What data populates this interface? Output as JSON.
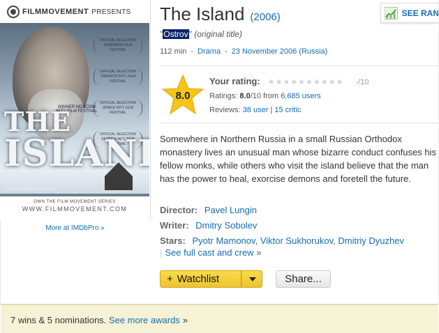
{
  "poster": {
    "brand": "FILMMOVEMENT",
    "brand_suffix": "PRESENTS",
    "title_the": "THE",
    "title_island": "ISLAND",
    "laurels": [
      "OFFICIAL SELECTION SUNDANCE FILM FESTIVAL",
      "OFFICIAL SELECTION TORONTO INT'L FILM FESTIVAL",
      "OFFICIAL SELECTION VENICE INT'L FILM FESTIVAL",
      "OFFICIAL SELECTION SEATTLE INT'L FILM FESTIVAL"
    ],
    "winner": "WINNER MOSCOW INT'L FILM FESTIVAL",
    "director_credit": "A FILM BY PAVEL LOUNGUINE",
    "series": "OWN THE FILM MOVEMENT SERIES",
    "url": "WWW.FILMMOVEMENT.COM",
    "more_link": "More at IMDbPro »"
  },
  "header": {
    "title": "The Island",
    "year": "(2006)",
    "orig_quote_open": "\"",
    "orig_title": "Ostrov",
    "orig_quote_close": "\"",
    "orig_label": "(original title)",
    "runtime": "112 min",
    "genre": "Drama",
    "release": "23 November 2006 (Russia)",
    "sep": "-"
  },
  "ranking": {
    "label": "SEE RAN"
  },
  "rating": {
    "score": "8.0",
    "your_rating_label": "Your rating:",
    "stars": "★★★★★★★★★★",
    "your_value": "-/10",
    "ratings_label": "Ratings:",
    "ratings_value": "8.0",
    "ratings_scale": "/10 from",
    "ratings_users": "6,685 users",
    "reviews_label": "Reviews:",
    "reviews_user": "38 user",
    "reviews_sep": "|",
    "reviews_critic": "15 critic"
  },
  "description": "Somewhere in Northern Russia in a small Russian Orthodox monastery lives an unusual man whose bizarre conduct confuses his fellow monks, while others who visit the island believe that the man has the power to heal, exorcise demons and foretell the future.",
  "credits": {
    "director_label": "Director:",
    "director": "Pavel Lungin",
    "writer_label": "Writer:",
    "writer": "Dmitry Sobolev",
    "stars_label": "Stars:",
    "star1": "Pyotr Mamonov",
    "star2": "Viktor Sukhorukov",
    "star3": "Dmitriy Dyuzhev",
    "comma": ",",
    "see_full_bar": "|",
    "see_full": "See full cast and crew",
    "see_full_chev": "»"
  },
  "actions": {
    "watchlist_plus": "+",
    "watchlist": "Watchlist",
    "share": "Share..."
  },
  "awards": {
    "text": "7 wins & 5 nominations.",
    "link": "See more awards",
    "chev": "»"
  },
  "colors": {
    "link": "#136cb2",
    "star": "#f5c518",
    "awards_bg": "#f6f2d6",
    "watchlist": "#f5d03b"
  }
}
